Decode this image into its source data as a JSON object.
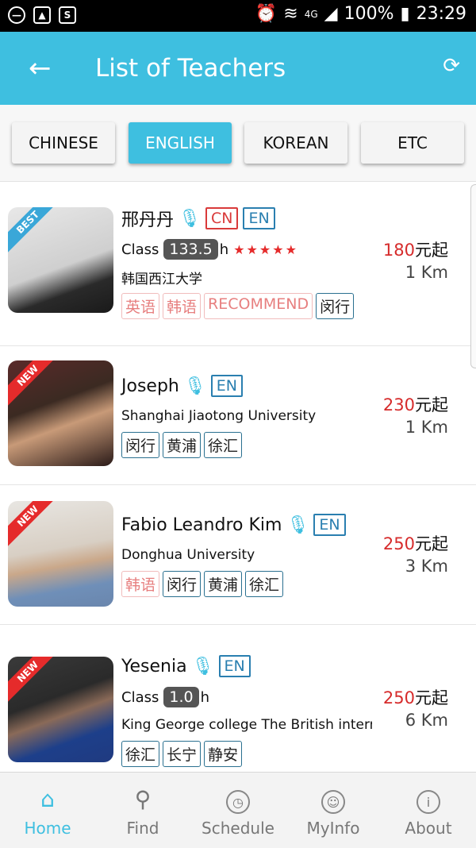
{
  "status_bar": {
    "battery": "100%",
    "time": "23:29",
    "network": "4G"
  },
  "app_bar": {
    "title": "List of Teachers"
  },
  "tabs": [
    {
      "label": "CHINESE",
      "active": false
    },
    {
      "label": "ENGLISH",
      "active": true
    },
    {
      "label": "KOREAN",
      "active": false
    },
    {
      "label": "ETC",
      "active": false
    }
  ],
  "teachers": [
    {
      "name": "邢丹丹",
      "ribbon": "BEST",
      "langs": [
        "CN",
        "EN"
      ],
      "class_prefix": "Class",
      "class_hours": "133.5",
      "class_suffix": "h",
      "stars": "★★★★★",
      "school": "韩国西江大学",
      "tags": [
        "英语",
        "韩语",
        "RECOMMEND",
        "闵行"
      ],
      "price_num": "180",
      "price_unit": "元起",
      "distance": "1 Km"
    },
    {
      "name": "Joseph",
      "ribbon": "NEW",
      "langs": [
        "EN"
      ],
      "school": "Shanghai Jiaotong University",
      "tags": [
        "闵行",
        "黄浦",
        "徐汇"
      ],
      "price_num": "230",
      "price_unit": "元起",
      "distance": "1 Km"
    },
    {
      "name": "Fabio Leandro Kim",
      "ribbon": "NEW",
      "langs": [
        "EN"
      ],
      "school": "Donghua University",
      "tags": [
        "韩语",
        "闵行",
        "黄浦",
        "徐汇"
      ],
      "price_num": "250",
      "price_unit": "元起",
      "distance": "3 Km"
    },
    {
      "name": "Yesenia",
      "ribbon": "NEW",
      "langs": [
        "EN"
      ],
      "class_prefix": "Class",
      "class_hours": "1.0",
      "class_suffix": "h",
      "school": "King George college The British international",
      "tags": [
        "徐汇",
        "长宁",
        "静安"
      ],
      "price_num": "250",
      "price_unit": "元起",
      "distance": "6 Km"
    }
  ],
  "bottom_nav": [
    {
      "label": "Home",
      "icon": "home-icon",
      "active": true
    },
    {
      "label": "Find",
      "icon": "search-icon",
      "active": false
    },
    {
      "label": "Schedule",
      "icon": "clock-icon",
      "active": false
    },
    {
      "label": "MyInfo",
      "icon": "user-icon",
      "active": false
    },
    {
      "label": "About",
      "icon": "info-icon",
      "active": false
    }
  ],
  "colors": {
    "accent": "#3ebfe0",
    "price": "#d62b2b",
    "status_bar": "#000000"
  }
}
